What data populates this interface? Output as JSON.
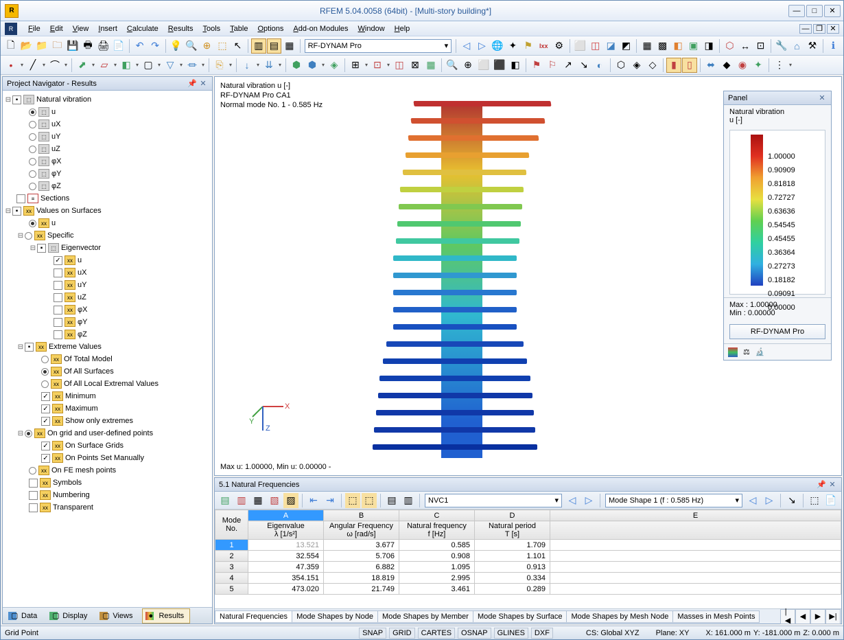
{
  "window": {
    "title": "RFEM 5.04.0058 (64bit) - [Multi-story building*]"
  },
  "menu": [
    "File",
    "Edit",
    "View",
    "Insert",
    "Calculate",
    "Results",
    "Tools",
    "Table",
    "Options",
    "Add-on Modules",
    "Window",
    "Help"
  ],
  "toolbar_combo": "RF-DYNAM Pro",
  "navigator": {
    "title": "Project Navigator - Results",
    "tabs": [
      "Data",
      "Display",
      "Views",
      "Results"
    ],
    "tree": {
      "natvib": "Natural vibration",
      "u": "u",
      "ux": "uX",
      "uy": "uY",
      "uz": "uZ",
      "phix": "φX",
      "phiy": "φY",
      "phiz": "φZ",
      "sections": "Sections",
      "vos": "Values on Surfaces",
      "specific": "Specific",
      "eigen": "Eigenvector",
      "extreme": "Extreme Values",
      "oftotal": "Of Total Model",
      "ofall": "Of All Surfaces",
      "ofloc": "Of All Local Extremal Values",
      "min": "Minimum",
      "max": "Maximum",
      "show": "Show only extremes",
      "ongrid": "On grid and user-defined points",
      "onsurf": "On Surface Grids",
      "onpts": "On Points Set Manually",
      "onfe": "On FE mesh points",
      "symbols": "Symbols",
      "numbering": "Numbering",
      "transparent": "Transparent"
    }
  },
  "viewport": {
    "line1": "Natural vibration u [-]",
    "line2": "RF-DYNAM Pro CA1",
    "line3": "Normal mode No. 1 - 0.585 Hz",
    "footer": "Max u: 1.00000, Min u: 0.00000 -"
  },
  "panel": {
    "title": "Panel",
    "subtitle1": "Natural vibration",
    "subtitle2": "u [-]",
    "ticks": [
      "1.00000",
      "0.90909",
      "0.81818",
      "0.72727",
      "0.63636",
      "0.54545",
      "0.45455",
      "0.36364",
      "0.27273",
      "0.18182",
      "0.09091",
      "0.00000"
    ],
    "max": "Max  :  1.00000",
    "min": "Min   :  0.00000",
    "btn": "RF-DYNAM Pro"
  },
  "lower": {
    "title": "5.1 Natural Frequencies",
    "combo1": "NVC1",
    "combo2": "Mode Shape 1 (f : 0.585 Hz)",
    "headers": {
      "mode": "Mode\nNo.",
      "A": "A",
      "B": "B",
      "C": "C",
      "D": "D",
      "E": "E",
      "eigen": "Eigenvalue\nλ [1/s²]",
      "ang": "Angular Frequency\nω [rad/s]",
      "nat": "Natural frequency\nf [Hz]",
      "per": "Natural period\nT [s]"
    },
    "rows": [
      {
        "n": "1",
        "a": "13.521",
        "b": "3.677",
        "c": "0.585",
        "d": "1.709"
      },
      {
        "n": "2",
        "a": "32.554",
        "b": "5.706",
        "c": "0.908",
        "d": "1.101"
      },
      {
        "n": "3",
        "a": "47.359",
        "b": "6.882",
        "c": "1.095",
        "d": "0.913"
      },
      {
        "n": "4",
        "a": "354.151",
        "b": "18.819",
        "c": "2.995",
        "d": "0.334"
      },
      {
        "n": "5",
        "a": "473.020",
        "b": "21.749",
        "c": "3.461",
        "d": "0.289"
      }
    ],
    "tabs": [
      "Natural Frequencies",
      "Mode Shapes by Node",
      "Mode Shapes by Member",
      "Mode Shapes by Surface",
      "Mode Shapes by Mesh Node",
      "Masses in Mesh Points"
    ]
  },
  "status": {
    "left": "Grid Point",
    "snap": "SNAP",
    "grid": "GRID",
    "cartes": "CARTES",
    "osnap": "OSNAP",
    "glines": "GLINES",
    "dxf": "DXF",
    "cs": "CS: Global XYZ",
    "plane": "Plane: XY",
    "x": "X:  161.000 m",
    "y": "Y:  -181.000 m",
    "z": "Z:  0.000 m"
  }
}
